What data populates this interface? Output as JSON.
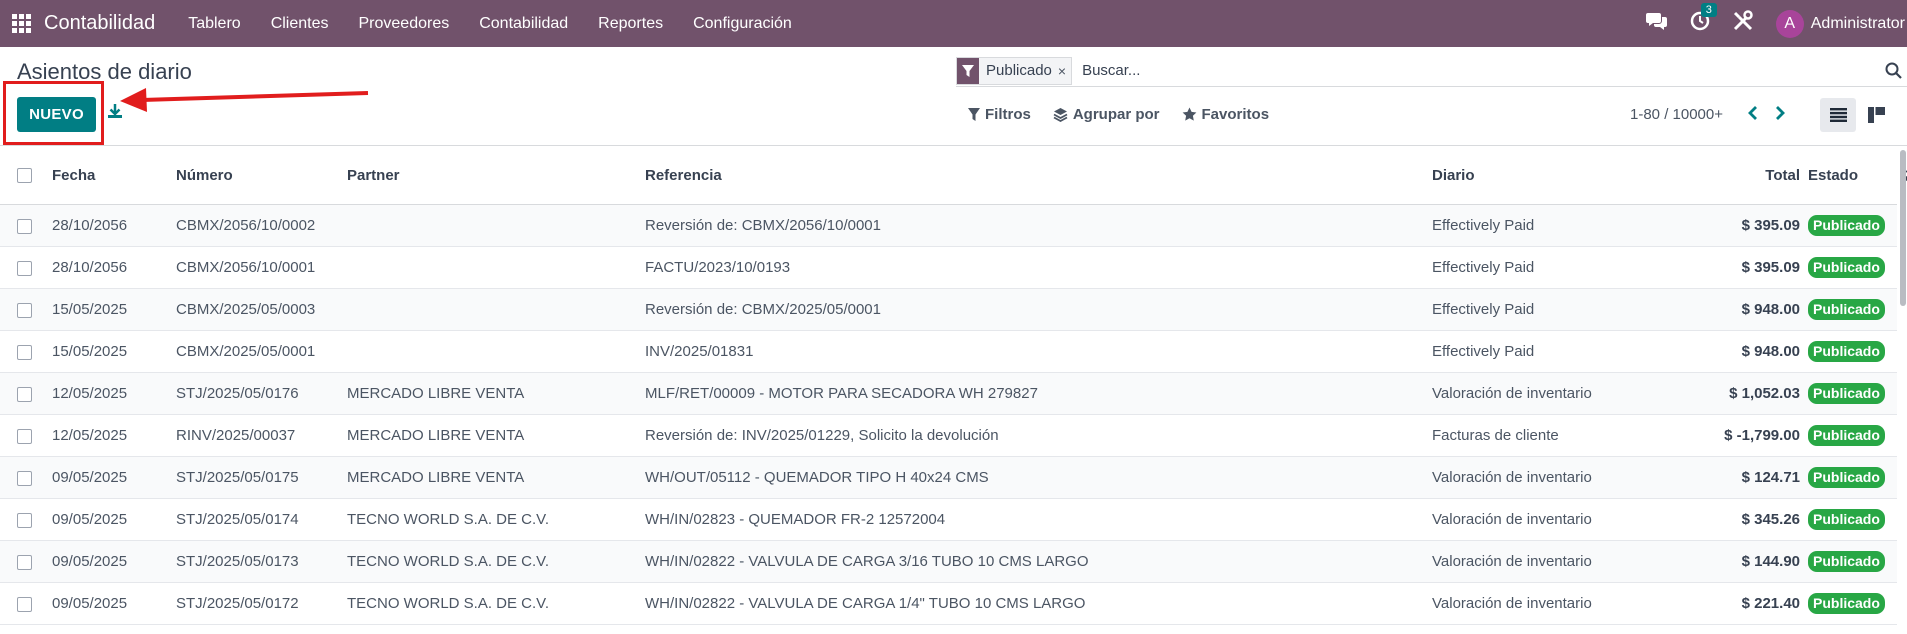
{
  "navbar": {
    "app_name": "Contabilidad",
    "menu": [
      "Tablero",
      "Clientes",
      "Proveedores",
      "Contabilidad",
      "Reportes",
      "Configuración"
    ],
    "activity_count": "3",
    "avatar_letter": "A",
    "user_name": "Administrator"
  },
  "page": {
    "title": "Asientos de diario",
    "new_button": "NUEVO"
  },
  "search": {
    "facet_value": "Publicado",
    "facet_remove": "×",
    "placeholder": "Buscar..."
  },
  "search_options": {
    "filters": "Filtros",
    "group_by": "Agrupar por",
    "favorites": "Favoritos"
  },
  "pager": {
    "value": "1-80 / 10000+"
  },
  "colors": {
    "brand": "#71526b",
    "primary": "#017e84",
    "success": "#28a745",
    "highlight": "#e11d1d"
  },
  "table": {
    "headers": {
      "fecha": "Fecha",
      "numero": "Número",
      "partner": "Partner",
      "referencia": "Referencia",
      "diario": "Diario",
      "total": "Total",
      "estado": "Estado"
    },
    "rows": [
      {
        "fecha": "28/10/2056",
        "numero": "CBMX/2056/10/0002",
        "partner": "",
        "referencia": "Reversión de: CBMX/2056/10/0001",
        "diario": "Effectively Paid",
        "total": "$ 395.09",
        "estado": "Publicado"
      },
      {
        "fecha": "28/10/2056",
        "numero": "CBMX/2056/10/0001",
        "partner": "",
        "referencia": "FACTU/2023/10/0193",
        "diario": "Effectively Paid",
        "total": "$ 395.09",
        "estado": "Publicado"
      },
      {
        "fecha": "15/05/2025",
        "numero": "CBMX/2025/05/0003",
        "partner": "",
        "referencia": "Reversión de: CBMX/2025/05/0001",
        "diario": "Effectively Paid",
        "total": "$ 948.00",
        "estado": "Publicado"
      },
      {
        "fecha": "15/05/2025",
        "numero": "CBMX/2025/05/0001",
        "partner": "",
        "referencia": "INV/2025/01831",
        "diario": "Effectively Paid",
        "total": "$ 948.00",
        "estado": "Publicado"
      },
      {
        "fecha": "12/05/2025",
        "numero": "STJ/2025/05/0176",
        "partner": "MERCADO LIBRE VENTA",
        "referencia": "MLF/RET/00009 - MOTOR PARA SECADORA WH 279827",
        "diario": "Valoración de inventario",
        "total": "$ 1,052.03",
        "estado": "Publicado"
      },
      {
        "fecha": "12/05/2025",
        "numero": "RINV/2025/00037",
        "partner": "MERCADO LIBRE VENTA",
        "referencia": "Reversión de: INV/2025/01229, Solicito la devolución",
        "diario": "Facturas de cliente",
        "total": "$ -1,799.00",
        "estado": "Publicado"
      },
      {
        "fecha": "09/05/2025",
        "numero": "STJ/2025/05/0175",
        "partner": "MERCADO LIBRE VENTA",
        "referencia": "WH/OUT/05112 - QUEMADOR TIPO H 40x24 CMS",
        "diario": "Valoración de inventario",
        "total": "$ 124.71",
        "estado": "Publicado"
      },
      {
        "fecha": "09/05/2025",
        "numero": "STJ/2025/05/0174",
        "partner": "TECNO WORLD S.A. DE C.V.",
        "referencia": "WH/IN/02823 - QUEMADOR FR-2 12572004",
        "diario": "Valoración de inventario",
        "total": "$ 345.26",
        "estado": "Publicado"
      },
      {
        "fecha": "09/05/2025",
        "numero": "STJ/2025/05/0173",
        "partner": "TECNO WORLD S.A. DE C.V.",
        "referencia": "WH/IN/02822 - VALVULA DE CARGA 3/16 TUBO 10 CMS LARGO",
        "diario": "Valoración de inventario",
        "total": "$ 144.90",
        "estado": "Publicado"
      },
      {
        "fecha": "09/05/2025",
        "numero": "STJ/2025/05/0172",
        "partner": "TECNO WORLD S.A. DE C.V.",
        "referencia": "WH/IN/02822 - VALVULA DE CARGA 1/4\" TUBO 10 CMS LARGO",
        "diario": "Valoración de inventario",
        "total": "$ 221.40",
        "estado": "Publicado"
      }
    ]
  }
}
